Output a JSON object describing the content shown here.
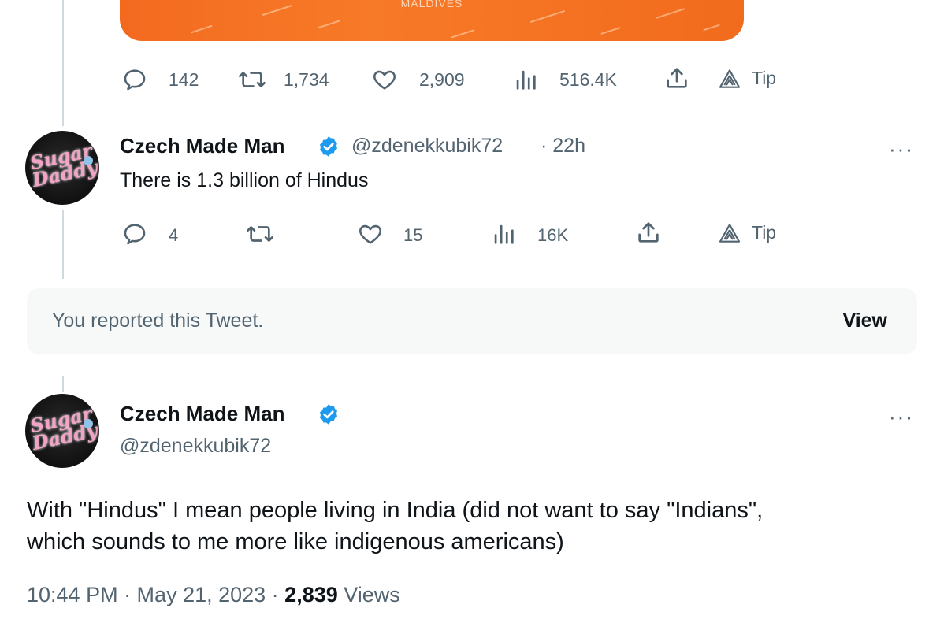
{
  "media": {
    "caption": "MALDIVES"
  },
  "tweet_top": {
    "actions": {
      "replies": "142",
      "retweets": "1,734",
      "likes": "2,909",
      "views": "516.4K",
      "tip": "Tip"
    }
  },
  "reply": {
    "name": "Czech Made Man",
    "handle": "@zdenekkubik72",
    "time": "· 22h",
    "text": "There is 1.3 billion of Hindus",
    "more": "···",
    "actions": {
      "replies": "4",
      "retweets": "",
      "likes": "15",
      "views": "16K",
      "tip": "Tip"
    }
  },
  "reported_notice": {
    "message": "You reported this Tweet.",
    "view_label": "View"
  },
  "main_tweet": {
    "name": "Czech Made Man",
    "handle": "@zdenekkubik72",
    "more": "···",
    "text_line1": "With \"Hindus\" I mean people living in India (did not want to say \"Indians\",",
    "text_line2": "which sounds to me more like indigenous americans)",
    "time": "10:44 PM · May 21, 2023 · ",
    "views_count": "2,839",
    "views_label": "Views"
  },
  "colors": {
    "accent": "#1d9bf0",
    "secondary_text": "#536471",
    "media_orange": "#f36a1f"
  },
  "icons": [
    "reply-icon",
    "retweet-icon",
    "like-icon",
    "views-icon",
    "share-icon",
    "tip-icon",
    "verified-badge-icon",
    "more-icon"
  ]
}
